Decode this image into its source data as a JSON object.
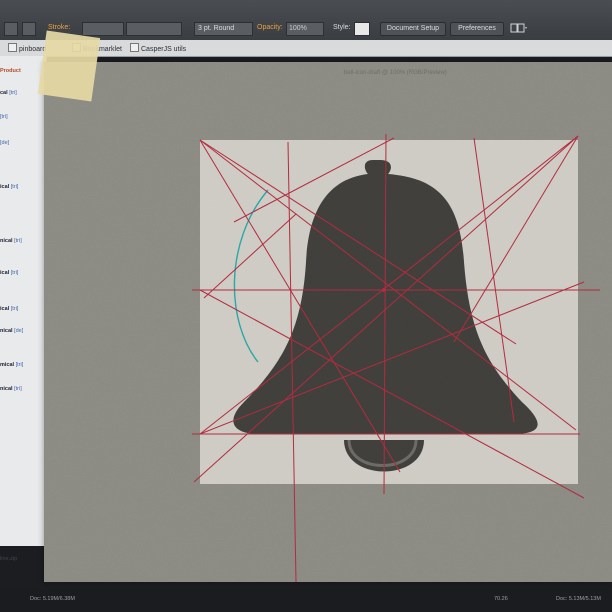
{
  "toolbar": {
    "stroke_label": "Stroke:",
    "brush_value": "3 pt. Round",
    "opacity_label": "Opacity:",
    "opacity_value": "100%",
    "style_label": "Style:",
    "document_setup_button": "Document Setup",
    "preferences_button": "Preferences"
  },
  "bookmarks": {
    "items": [
      "pinboard",
      "Bookmarklet",
      "CasperJS utils"
    ]
  },
  "left_panel": {
    "header": "Product",
    "rows": [
      {
        "a": "cal",
        "b": "[tri]"
      },
      {
        "a": "",
        "b": "[tri]"
      },
      {
        "a": "",
        "b": "[de]"
      },
      {
        "a": "ical",
        "b": "[tri]"
      },
      {
        "a": "nical",
        "b": "[tri]"
      },
      {
        "a": "ical",
        "b": "[tri]"
      },
      {
        "a": "ical",
        "b": "[tri]"
      },
      {
        "a": "nical",
        "b": "[de]"
      },
      {
        "a": "mical",
        "b": "[tri]"
      },
      {
        "a": "nical",
        "b": "[tri]"
      }
    ],
    "file_label": "line.zip"
  },
  "canvas": {
    "window_title": "bell-icon-draft @ 100% (RGB/Preview)"
  },
  "status": {
    "left_doc": "Doc: 5.19M/6.38M",
    "zoom": "70.26",
    "right_doc": "Doc: 5.13M/5.13M"
  },
  "colors": {
    "guide_red": "#b3293e",
    "guide_teal": "#2aa6a6",
    "paper": "#8c8b84",
    "bell": "#3f3e3a"
  }
}
